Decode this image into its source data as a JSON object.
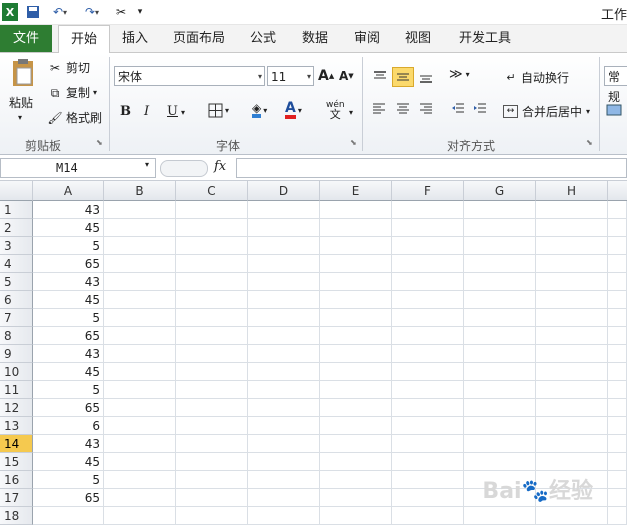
{
  "title_bar": {
    "title": "工作",
    "undo_icon": "undo-icon",
    "redo_icon": "redo-icon"
  },
  "tabs": [
    {
      "label": "文件"
    },
    {
      "label": "开始"
    },
    {
      "label": "插入"
    },
    {
      "label": "页面布局"
    },
    {
      "label": "公式"
    },
    {
      "label": "数据"
    },
    {
      "label": "审阅"
    },
    {
      "label": "视图"
    },
    {
      "label": "开发工具"
    }
  ],
  "ribbon": {
    "clipboard": {
      "paste": "粘贴",
      "cut": "剪切",
      "copy": "复制",
      "format_painter": "格式刷",
      "group": "剪贴板"
    },
    "font": {
      "name": "宋体",
      "size": "11",
      "bold": "B",
      "italic": "I",
      "underline": "U",
      "font_color": "A",
      "group": "字体"
    },
    "alignment": {
      "wrap": "自动换行",
      "merge": "合并后居中",
      "group": "对齐方式",
      "wen": "wén"
    },
    "number": {
      "format": "常规"
    }
  },
  "formula_bar": {
    "name_box": "M14",
    "fx": "fx",
    "value": ""
  },
  "grid": {
    "columns": [
      "A",
      "B",
      "C",
      "D",
      "E",
      "F",
      "G",
      "H"
    ],
    "rows": [
      {
        "n": "1",
        "a": "43"
      },
      {
        "n": "2",
        "a": "45"
      },
      {
        "n": "3",
        "a": "5"
      },
      {
        "n": "4",
        "a": "65"
      },
      {
        "n": "5",
        "a": "43"
      },
      {
        "n": "6",
        "a": "45"
      },
      {
        "n": "7",
        "a": "5"
      },
      {
        "n": "8",
        "a": "65"
      },
      {
        "n": "9",
        "a": "43"
      },
      {
        "n": "10",
        "a": "45"
      },
      {
        "n": "11",
        "a": "5"
      },
      {
        "n": "12",
        "a": "65"
      },
      {
        "n": "13",
        "a": "6"
      },
      {
        "n": "14",
        "a": "43"
      },
      {
        "n": "15",
        "a": "45"
      },
      {
        "n": "16",
        "a": "5"
      },
      {
        "n": "17",
        "a": "65"
      },
      {
        "n": "18",
        "a": ""
      }
    ],
    "active_row": "14"
  },
  "colors": {
    "file_tab": "#2e7d32",
    "active_row_header": "#f5c94f"
  }
}
